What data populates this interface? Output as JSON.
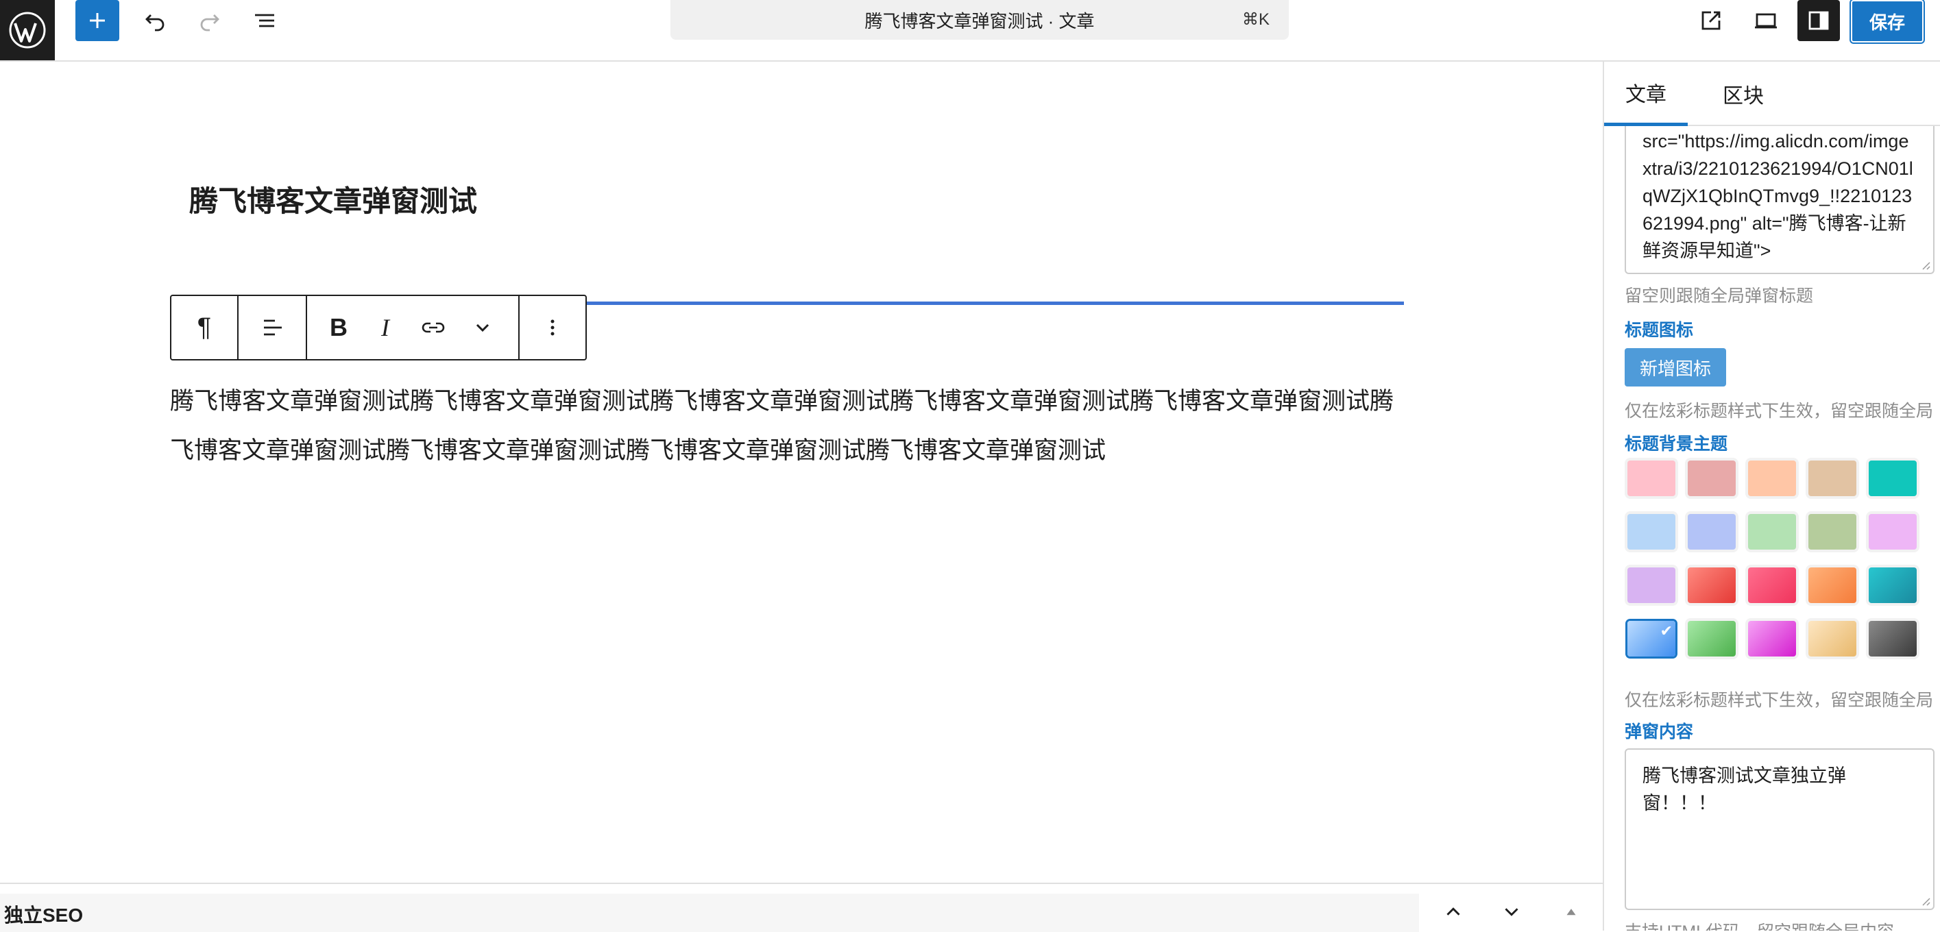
{
  "topbar": {
    "doc_title": "腾飞博客文章弹窗测试 · 文章",
    "shortcut": "⌘K",
    "add_label": "+",
    "save_label": "保存"
  },
  "editor": {
    "post_title": "腾飞博客文章弹窗测试",
    "paragraph": "腾飞博客文章弹窗测试腾飞博客文章弹窗测试腾飞博客文章弹窗测试腾飞博客文章弹窗测试腾飞博客文章弹窗测试腾飞博客文章弹窗测试腾飞博客文章弹窗测试腾飞博客文章弹窗测试腾飞博客文章弹窗测试",
    "toolbar": {
      "paragraph_icon": "pilcrow-icon",
      "align_icon": "align-left-icon",
      "bold": "B",
      "italic": "I",
      "link_icon": "link-icon",
      "more_icon": "chevron-down-icon",
      "options_icon": "more-vertical-icon"
    }
  },
  "seo": {
    "label": "独立SEO"
  },
  "sidebar": {
    "tabs": [
      "文章",
      "区块"
    ],
    "title_code": "src=\"https://img.alicdn.com/imgextra/i3/2210123621994/O1CN01lqWZjX1QbInQTmvg9_!!2210123621994.png\" alt=\"腾飞博客-让新鲜资源早知道\">",
    "hint_title": "留空则跟随全局弹窗标题",
    "label_icon": "标题图标",
    "add_icon_button": "新增图标",
    "hint_style": "仅在炫彩标题样式下生效，留空跟随全局",
    "label_bg_theme": "标题背景主题",
    "label_popup_content": "弹窗内容",
    "popup_content": "腾飞博客测试文章独立弹窗！！！",
    "hint_html": "支持HTML代码，留空跟随全局内容",
    "selected_swatch_index": 15,
    "swatches": [
      "#ffc0cb",
      "#e8a9a9",
      "#ffc6a6",
      "#e2c3a3",
      "#11c6bb",
      "#b6d6f8",
      "#b3c3f7",
      "#b3e2b3",
      "#b5cc9c",
      "#eeb6f6",
      "#d8b3f2",
      "linear-gradient(135deg,#ff8a80,#e53935)",
      "linear-gradient(135deg,#ff6e8e,#f0345c)",
      "linear-gradient(135deg,#ffb27a,#f57c3a)",
      "linear-gradient(135deg,#28c6cf,#1a8a9f)",
      "linear-gradient(135deg,#bcdcff,#3f8ef0)",
      "linear-gradient(135deg,#a6e8a6,#4cb04c)",
      "linear-gradient(135deg,#f5a3f5,#d41ecf)",
      "linear-gradient(135deg,#fde6c2,#e8b86b)",
      "linear-gradient(135deg,#8a8a8a,#3a3a3a)"
    ]
  }
}
